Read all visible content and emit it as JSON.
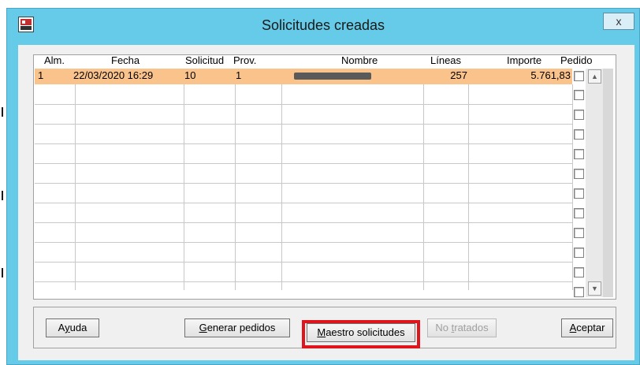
{
  "window": {
    "title": "Solicitudes creadas",
    "close_glyph": "x",
    "app_icon": "app-icon"
  },
  "table": {
    "headers": {
      "alm": "Alm.",
      "fecha": "Fecha",
      "solicitud": "Solicitud",
      "prov": "Prov.",
      "nombre": "Nombre",
      "lineas": "Líneas",
      "importe": "Importe",
      "pedido": "Pedido"
    },
    "rows": [
      {
        "alm": "1",
        "fecha": "22/03/2020 16:29",
        "solicitud": "10",
        "prov": "1",
        "nombre": "",
        "lineas": "257",
        "importe": "5.761,83",
        "pedido": false,
        "selected": true
      }
    ],
    "empty_rows": 10,
    "selected_row_color": "#fbc38c"
  },
  "buttons": {
    "ayuda": {
      "pre": "A",
      "u": "y",
      "post": "uda"
    },
    "generar": {
      "pre": "",
      "u": "G",
      "post": "enerar pedidos"
    },
    "maestro": {
      "pre": "",
      "u": "M",
      "post": "aestro solicitudes"
    },
    "no_tratados": {
      "pre": "No ",
      "u": "t",
      "post": "ratados"
    },
    "aceptar": {
      "pre": "",
      "u": "A",
      "post": "ceptar"
    }
  },
  "colors": {
    "title_bar": "#65cbe8",
    "highlight": "#e0141c"
  }
}
